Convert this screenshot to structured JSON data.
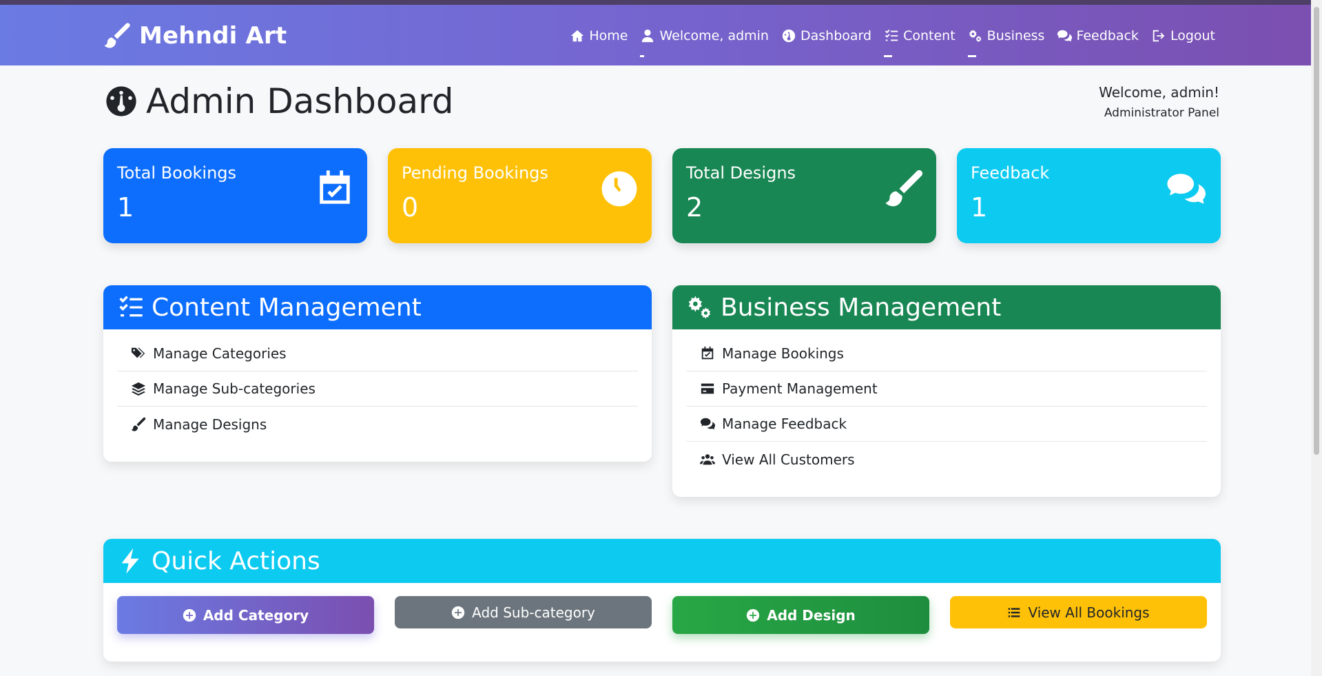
{
  "brand": {
    "name": "Mehndi Art",
    "icon": "paintbrush-icon"
  },
  "nav": [
    {
      "label": "Home",
      "icon": "home-icon"
    },
    {
      "label": "Welcome, admin",
      "icon": "user-icon"
    },
    {
      "label": "Dashboard",
      "icon": "gauge-icon"
    },
    {
      "label": "Content",
      "icon": "list-check-icon"
    },
    {
      "label": "Business",
      "icon": "gears-icon"
    },
    {
      "label": "Feedback",
      "icon": "comments-icon"
    },
    {
      "label": "Logout",
      "icon": "logout-icon"
    }
  ],
  "header": {
    "title": "Admin Dashboard",
    "welcome": "Welcome, admin!",
    "role": "Administrator Panel"
  },
  "stats": [
    {
      "label": "Total Bookings",
      "value": "1",
      "color": "#0d6efd",
      "icon": "calendar-check-icon"
    },
    {
      "label": "Pending Bookings",
      "value": "0",
      "color": "#ffc107",
      "icon": "clock-icon"
    },
    {
      "label": "Total Designs",
      "value": "2",
      "color": "#198754",
      "icon": "paintbrush-icon"
    },
    {
      "label": "Feedback",
      "value": "1",
      "color": "#0dcaf0",
      "icon": "comments-icon"
    }
  ],
  "content_panel": {
    "title": "Content Management",
    "color": "#0d6efd",
    "items": [
      {
        "label": "Manage Categories",
        "icon": "tags-icon"
      },
      {
        "label": "Manage Sub-categories",
        "icon": "layers-icon"
      },
      {
        "label": "Manage Designs",
        "icon": "paintbrush-icon"
      }
    ]
  },
  "business_panel": {
    "title": "Business Management",
    "color": "#198754",
    "items": [
      {
        "label": "Manage Bookings",
        "icon": "calendar-check-icon"
      },
      {
        "label": "Payment Management",
        "icon": "credit-card-icon"
      },
      {
        "label": "Manage Feedback",
        "icon": "comments-icon"
      },
      {
        "label": "View All Customers",
        "icon": "users-icon"
      }
    ]
  },
  "quick_actions": {
    "title": "Quick Actions",
    "color": "#0dcaf0",
    "buttons": [
      {
        "label": "Add Category",
        "icon": "plus-circle-icon"
      },
      {
        "label": "Add Sub-category",
        "icon": "plus-circle-icon"
      },
      {
        "label": "Add Design",
        "icon": "plus-circle-icon"
      },
      {
        "label": "View All Bookings",
        "icon": "list-icon"
      }
    ]
  }
}
